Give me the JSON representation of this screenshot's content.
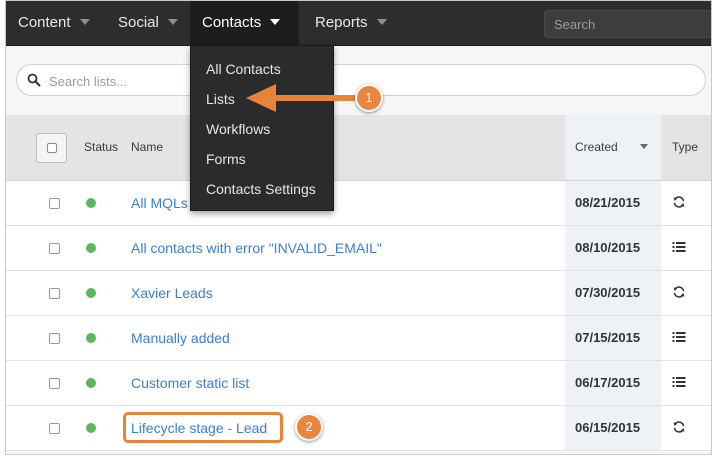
{
  "topnav": {
    "items": [
      {
        "label": "Content"
      },
      {
        "label": "Social"
      },
      {
        "label": "Contacts"
      },
      {
        "label": "Reports"
      }
    ],
    "search_placeholder": "Search"
  },
  "list_search": {
    "placeholder": "Search lists..."
  },
  "dropdown": {
    "items": [
      {
        "label": "All Contacts"
      },
      {
        "label": "Lists"
      },
      {
        "label": "Workflows"
      },
      {
        "label": "Forms"
      },
      {
        "label": "Contacts Settings"
      }
    ]
  },
  "table": {
    "headers": {
      "status": "Status",
      "name": "Name",
      "created": "Created",
      "type": "Type"
    },
    "rows": [
      {
        "name": "All MQLs",
        "created": "08/21/2015",
        "type_icon": "refresh-icon"
      },
      {
        "name": "All contacts with error \"INVALID_EMAIL\"",
        "created": "08/10/2015",
        "type_icon": "list-icon"
      },
      {
        "name": "Xavier Leads",
        "created": "07/30/2015",
        "type_icon": "refresh-icon"
      },
      {
        "name": "Manually added",
        "created": "07/15/2015",
        "type_icon": "list-icon"
      },
      {
        "name": "Customer static list",
        "created": "06/17/2015",
        "type_icon": "list-icon"
      },
      {
        "name": "Lifecycle stage - Lead",
        "created": "06/15/2015",
        "type_icon": "refresh-icon"
      }
    ]
  },
  "callouts": [
    {
      "number": "1"
    },
    {
      "number": "2"
    }
  ],
  "colors": {
    "nav_bg": "#2d2d2d",
    "link": "#3a7fd0",
    "status_active": "#5cb85c",
    "callout": "#e9853c",
    "created_column": "#eef2f7"
  }
}
